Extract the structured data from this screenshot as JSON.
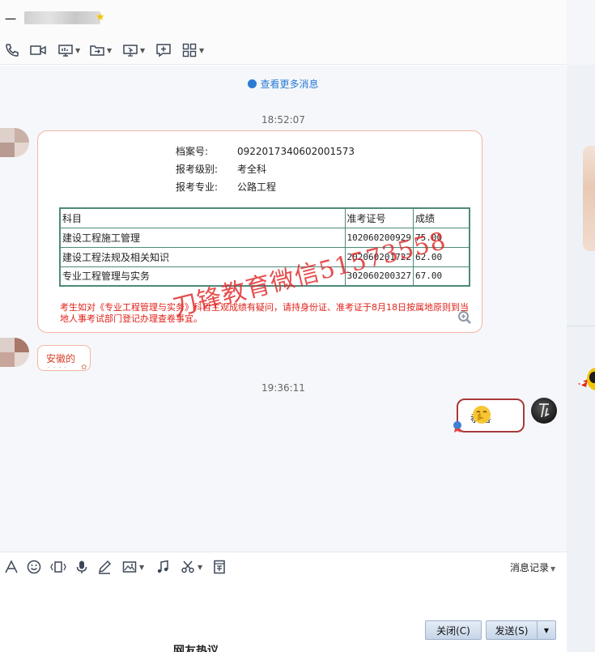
{
  "window": {
    "title_prefix": "一"
  },
  "chat": {
    "more_messages": "查看更多消息",
    "time1": "18:52:07",
    "time2": "19:36:11",
    "card": {
      "rows": [
        {
          "label": "档案号:",
          "value": "0922017340602001573"
        },
        {
          "label": "报考级别:",
          "value": "考全科"
        },
        {
          "label": "报考专业:",
          "value": "公路工程"
        }
      ],
      "table_header": [
        "科目",
        "准考证号",
        "成绩"
      ],
      "table_rows": [
        [
          "建设工程施工管理",
          "102060200929",
          "75.00"
        ],
        [
          "建设工程法规及相关知识",
          "202060201722",
          "62.00"
        ],
        [
          "专业工程管理与实务",
          "302060200327",
          "67.00"
        ]
      ],
      "notice": "考生如对《专业工程管理与实务》科目主观成绩有疑问，请持身份证、准考证于8月18日按属地原则到当地人事考试部门登记办理查卷事宜。"
    },
    "reply_message": "安徽的",
    "my_message": "恭喜"
  },
  "watermark": "刀锋教育微信51573558",
  "input": {
    "history_label": "消息记录",
    "close_label": "关闭(C)",
    "send_label": "发送(S)"
  },
  "below": {
    "text": "网友热议"
  }
}
